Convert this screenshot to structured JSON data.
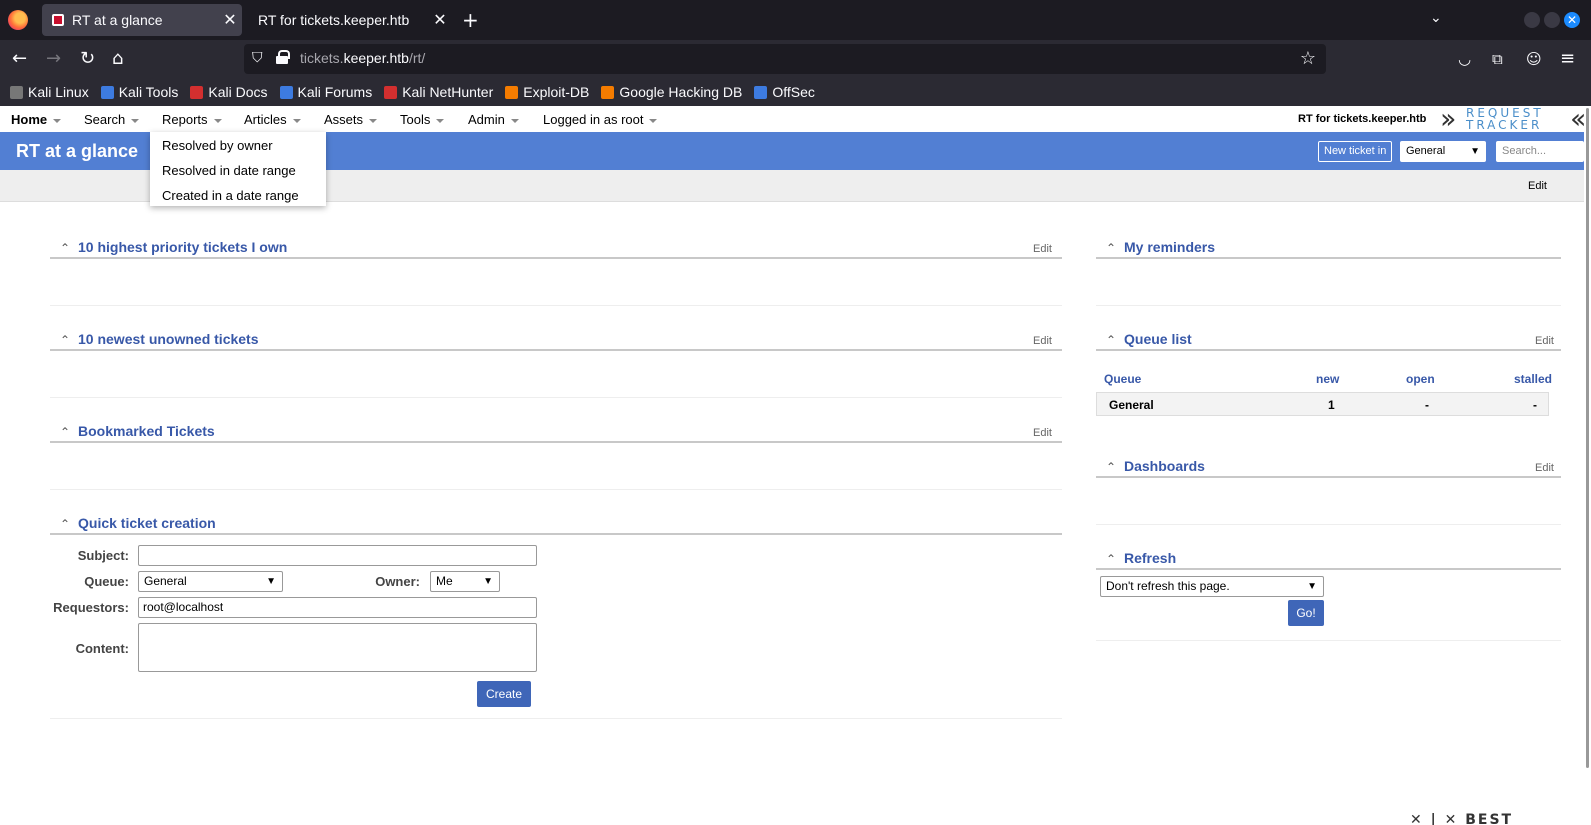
{
  "browser": {
    "tabs": [
      {
        "title": "RT at a glance",
        "active": true
      },
      {
        "title": "RT for tickets.keeper.htb",
        "active": false
      }
    ],
    "url_host_pre": "tickets.",
    "url_host": "keeper.htb",
    "url_path": "/rt/",
    "bookmarks": [
      {
        "label": "Kali Linux",
        "color": "#2b2a33"
      },
      {
        "label": "Kali Tools",
        "color": "#3d7be0"
      },
      {
        "label": "Kali Docs",
        "color": "#d32f2f"
      },
      {
        "label": "Kali Forums",
        "color": "#3d7be0"
      },
      {
        "label": "Kali NetHunter",
        "color": "#d32f2f"
      },
      {
        "label": "Exploit-DB",
        "color": "#f57c00"
      },
      {
        "label": "Google Hacking DB",
        "color": "#f57c00"
      },
      {
        "label": "OffSec",
        "color": "#3d7be0"
      }
    ]
  },
  "rt": {
    "menu": [
      "Home",
      "Search",
      "Reports",
      "Articles",
      "Assets",
      "Tools",
      "Admin",
      "Logged in as root"
    ],
    "rt_for": "RT for tickets.keeper.htb",
    "logo_words_1": "REQUEST",
    "logo_words_2": "TRACKER",
    "page_title": "RT at a glance",
    "new_ticket_label": "New ticket in",
    "queue_selected": "General",
    "search_placeholder": "Search...",
    "edit_label": "Edit",
    "reports_dropdown": [
      "Resolved by owner",
      "Resolved in date range",
      "Created in a date range"
    ]
  },
  "widgets": {
    "left": [
      {
        "title": "10 highest priority tickets I own",
        "edit": "Edit"
      },
      {
        "title": "10 newest unowned tickets",
        "edit": "Edit"
      },
      {
        "title": "Bookmarked Tickets",
        "edit": "Edit"
      },
      {
        "title": "Quick ticket creation"
      }
    ],
    "right": [
      {
        "title": "My reminders"
      },
      {
        "title": "Queue list",
        "edit": "Edit"
      },
      {
        "title": "Dashboards",
        "edit": "Edit"
      },
      {
        "title": "Refresh"
      }
    ]
  },
  "quick_create": {
    "subject_label": "Subject:",
    "subject_value": "",
    "queue_label": "Queue:",
    "queue_value": "General",
    "owner_label": "Owner:",
    "owner_value": "Me",
    "requestors_label": "Requestors:",
    "requestors_value": "root@localhost",
    "content_label": "Content:",
    "create_label": "Create"
  },
  "queue_list": {
    "headers": [
      "Queue",
      "new",
      "open",
      "stalled"
    ],
    "rows": [
      {
        "queue": "General",
        "new": "1",
        "open": "-",
        "stalled": "-"
      }
    ]
  },
  "refresh": {
    "selected": "Don't refresh this page.",
    "go_label": "Go!"
  },
  "footer_logo": "BEST"
}
